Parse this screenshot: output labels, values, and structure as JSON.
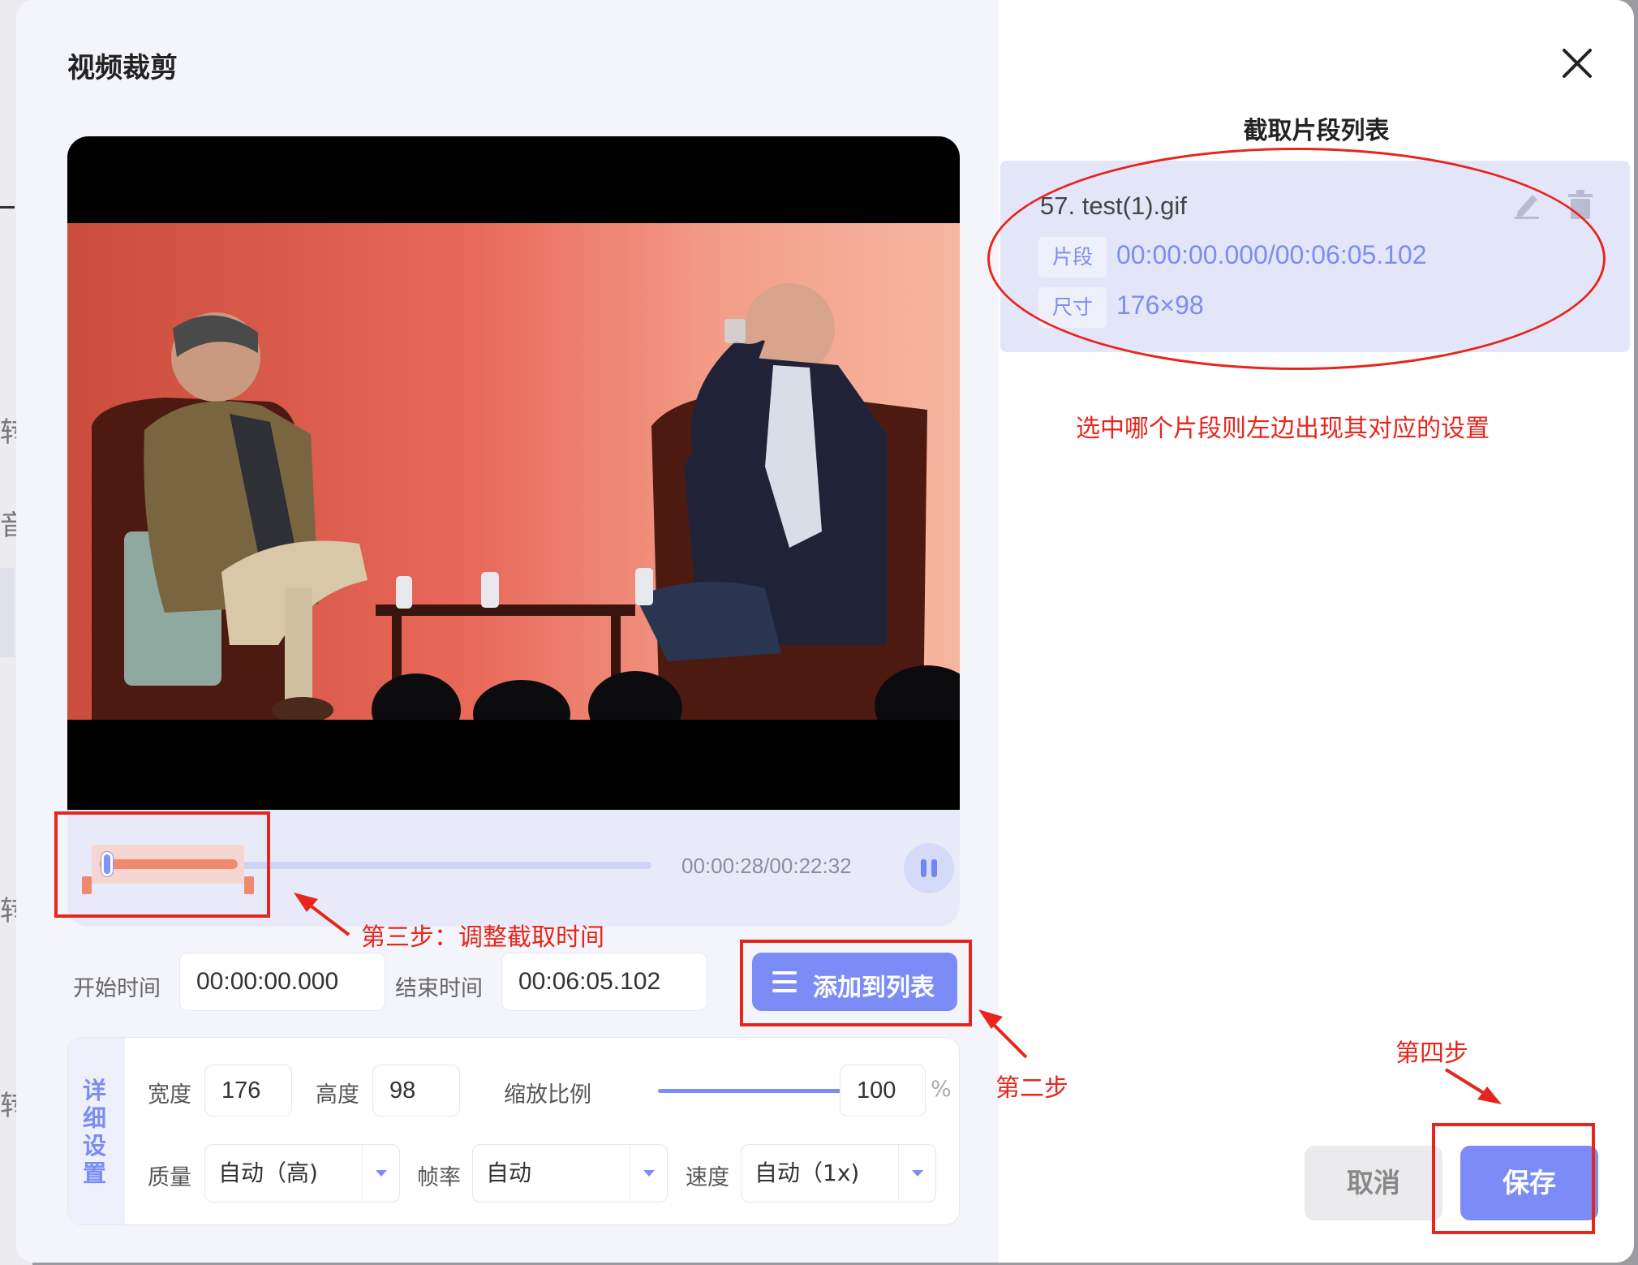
{
  "dialog": {
    "title": "视频裁剪"
  },
  "background_fragments": [
    "转",
    "音",
    "",
    "转",
    "转"
  ],
  "player": {
    "time_display": "00:00:28/00:22:32",
    "progress_fraction": 0.021
  },
  "time_range": {
    "start_label": "开始时间",
    "start_value": "00:00:00.000",
    "end_label": "结束时间",
    "end_value": "00:06:05.102",
    "add_button": "添加到列表"
  },
  "settings": {
    "tab_label": "详细设置",
    "width_label": "宽度",
    "width_value": "176",
    "height_label": "高度",
    "height_value": "98",
    "scale_label": "缩放比例",
    "scale_value": "100",
    "scale_unit": "%",
    "quality_label": "质量",
    "quality_value": "自动（高)",
    "fps_label": "帧率",
    "fps_value": "自动",
    "speed_label": "速度",
    "speed_value": "自动（1x)"
  },
  "clip_list": {
    "title": "截取片段列表",
    "items": [
      {
        "name": "57. test(1).gif",
        "segment_tag": "片段",
        "segment_value": "00:00:00.000/00:06:05.102",
        "size_tag": "尺寸",
        "size_value": "176×98"
      }
    ]
  },
  "footer": {
    "cancel": "取消",
    "save": "保存"
  },
  "annotations": {
    "note_right": "选中哪个片段则左边出现其对应的设置",
    "step2": "第二步",
    "step3": "第三步：调整截取时间",
    "step4": "第四步"
  },
  "colors": {
    "accent": "#7c8cf6",
    "annotation_red": "#e8251c",
    "selection_orange": "#f08a6e"
  }
}
